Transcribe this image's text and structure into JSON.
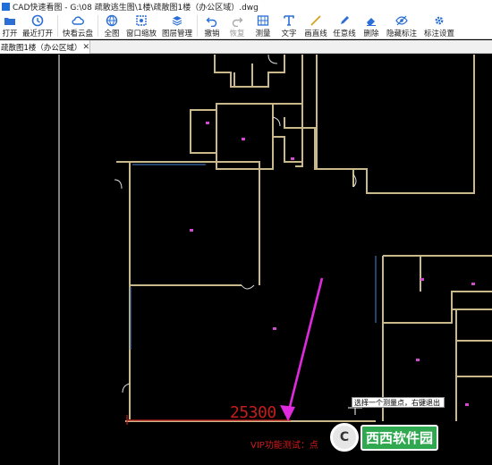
{
  "window": {
    "title": "CAD快速看图 - G:\\08 疏散逃生图\\1楼\\疏散图1楼（办公区域）.dwg"
  },
  "toolbar": {
    "open": "打开",
    "recent": "最近打开",
    "cloud": "快看云盘",
    "full": "全图",
    "window_zoom": "窗口缩放",
    "layers": "图层管理",
    "undo": "撤销",
    "redo": "恢复",
    "measure": "测量",
    "text": "文字",
    "line": "画直线",
    "freehand": "任意线",
    "erase": "删除",
    "hide_marks": "隐藏标注",
    "mark_settings": "标注设置"
  },
  "tab": {
    "label": "疏散图1楼（办公区域）",
    "close": "✕"
  },
  "canvas": {
    "measure_value": "25300",
    "tooltip": "选择一个测量点，右键退出",
    "vip_text": "VIP功能测试：点",
    "arrow_color": "#e02ae0",
    "wall_color": "#c8b88a",
    "measure_color": "#c61c1c"
  },
  "watermark": {
    "logo": "C",
    "text": "西西软件园"
  }
}
